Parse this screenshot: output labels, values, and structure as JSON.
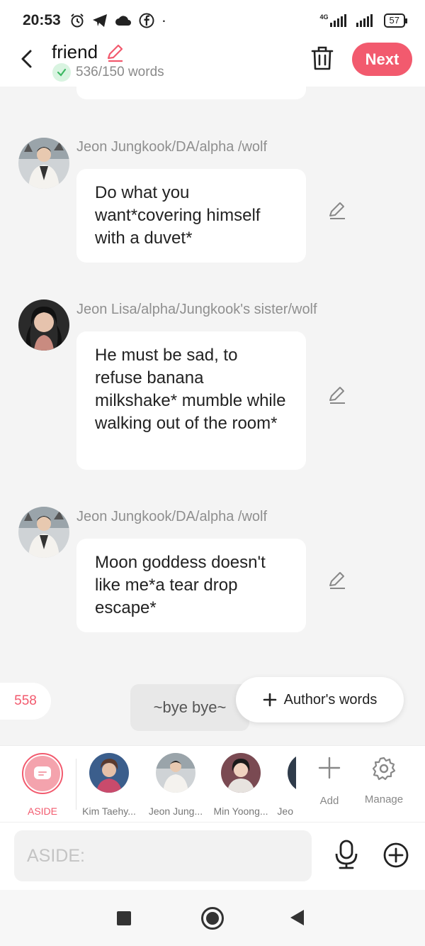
{
  "status": {
    "time": "20:53",
    "battery": "57",
    "network": "4G"
  },
  "header": {
    "title": "friend",
    "word_count": "536/150 words",
    "next_label": "Next"
  },
  "messages": [
    {
      "name": "Jeon Jungkook/DA/alpha /wolf",
      "text": "Do what you want*covering himself with a duvet*",
      "avatar": "jungkook"
    },
    {
      "name": "Jeon Lisa/alpha/Jungkook's sister/wolf",
      "text": "He must be sad, to refuse banana milkshake* mumble while walking out of the room*",
      "avatar": "lisa"
    },
    {
      "name": "Jeon Jungkook/DA/alpha /wolf",
      "text": "Moon goddess doesn't like me*a tear drop escape*",
      "avatar": "jungkook"
    }
  ],
  "message_count": "558",
  "draft_bubble": "~bye bye~",
  "author_words_label": "Author's words",
  "characters": [
    {
      "label": "ASIDE",
      "selected": true
    },
    {
      "label": "Kim Taehy..."
    },
    {
      "label": "Jeon Jung..."
    },
    {
      "label": "Min Yoong..."
    },
    {
      "label": "Jeo"
    }
  ],
  "tools": {
    "add_label": "Add",
    "manage_label": "Manage"
  },
  "input": {
    "placeholder": "ASIDE:"
  },
  "colors": {
    "accent": "#f25a6e",
    "background": "#f4f4f4"
  }
}
